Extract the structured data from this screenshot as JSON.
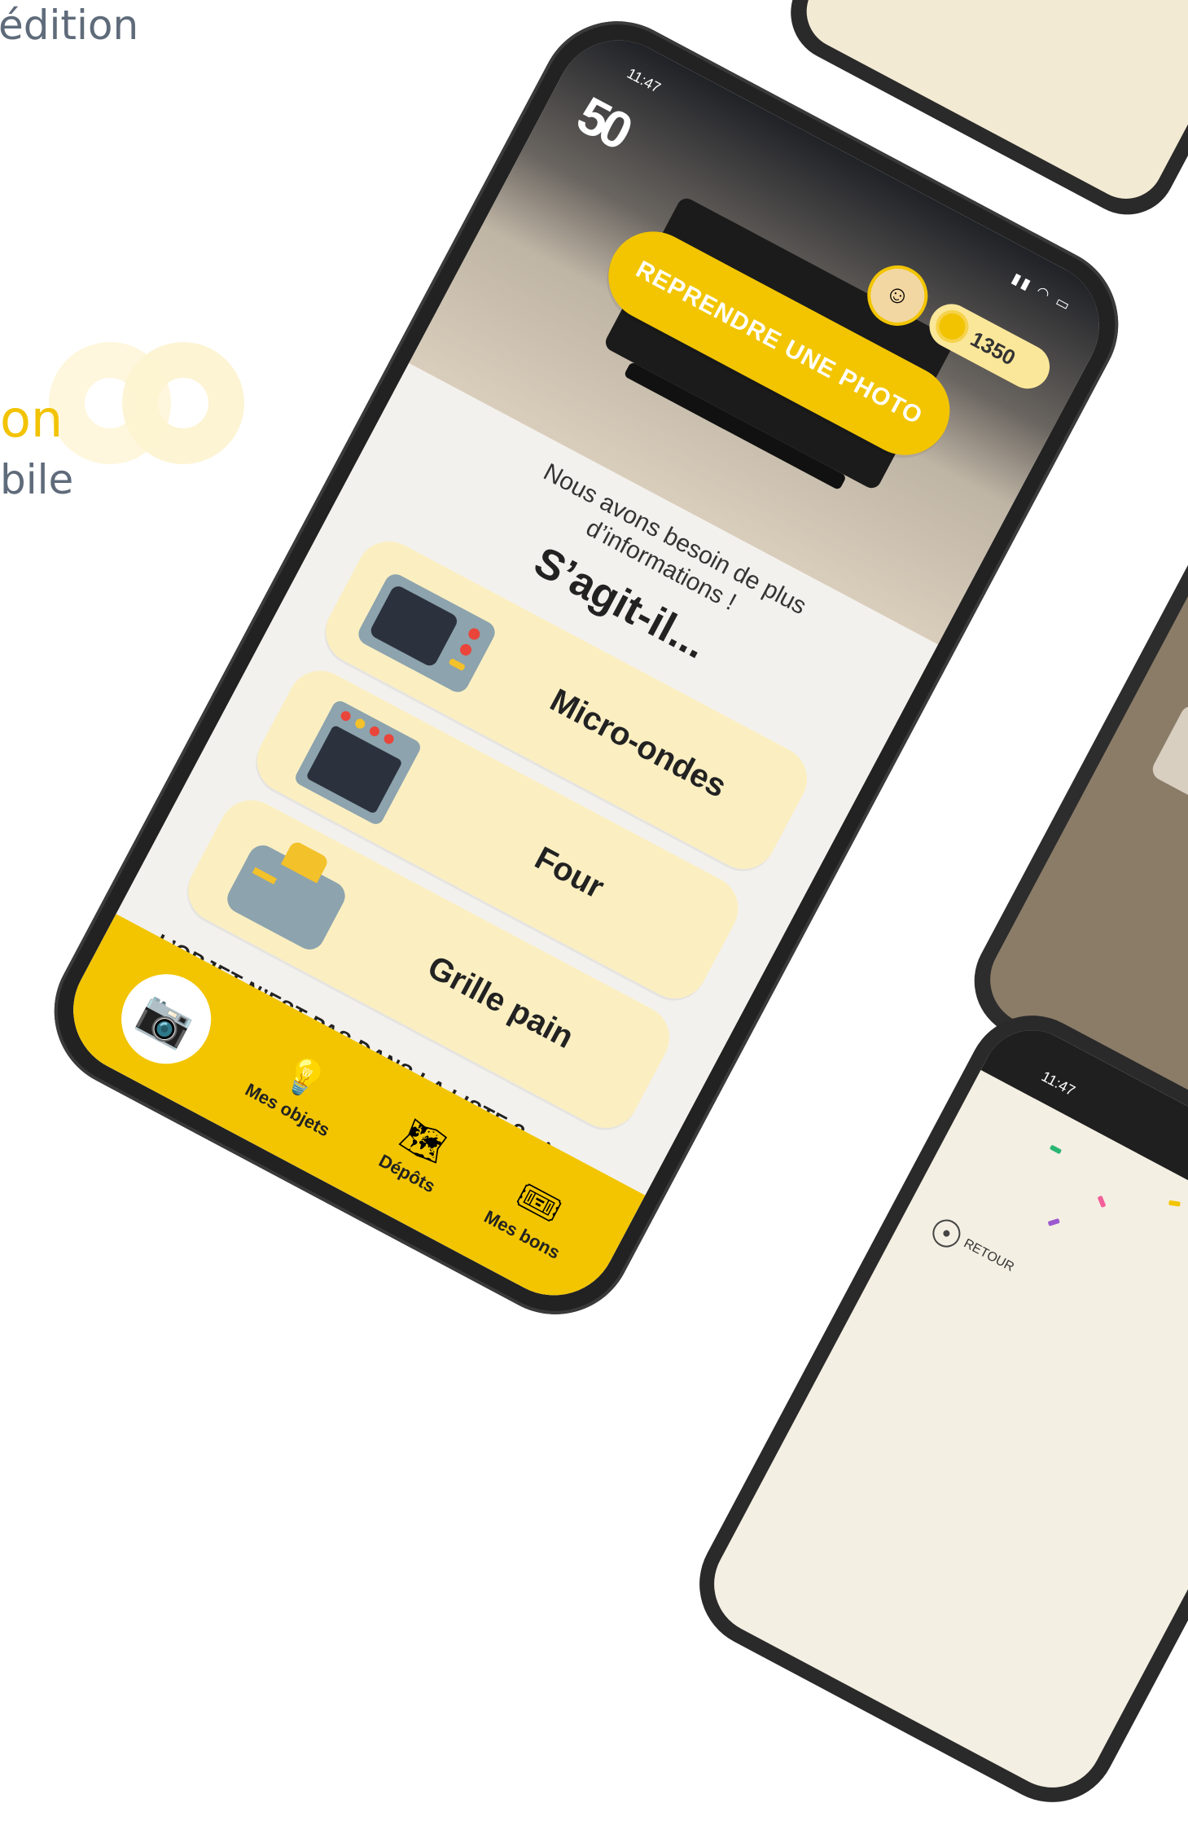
{
  "background": {
    "left_text": [
      "édition",
      "on",
      "bile"
    ],
    "accent": "#f2c300",
    "text_color": "#5f6b7a"
  },
  "main_phone": {
    "status_time": "11:47",
    "logo_text": "50",
    "coins": "1350",
    "retake_button": "REPRENDRE UNE PHOTO",
    "need_info": "Nous avons besoin de plus d’informations !",
    "question": "S’agit-il...",
    "options": [
      {
        "label": "Micro-ondes",
        "icon": "microwave-icon"
      },
      {
        "label": "Four",
        "icon": "oven-icon"
      },
      {
        "label": "Grille pain",
        "icon": "toaster-icon"
      }
    ],
    "not_in_list": "L’OBJET N’EST PAS DANS LA LISTE ?",
    "not_in_list_arrow": "➜",
    "tabs": [
      {
        "label": "Mes objets",
        "icon": "lightbulb-icon"
      },
      {
        "label": "Dépôts",
        "icon": "map-icon"
      },
      {
        "label": "Mes bons",
        "icon": "voucher-icon"
      }
    ],
    "camera_icon": "camera-icon",
    "status_icons": "signal wifi battery"
  },
  "bottom_phone": {
    "status_time": "11:47",
    "back_label": "RETOUR"
  },
  "colors": {
    "yellow": "#f2c500",
    "option_bg": "#fbefc2",
    "frame": "#222222"
  }
}
